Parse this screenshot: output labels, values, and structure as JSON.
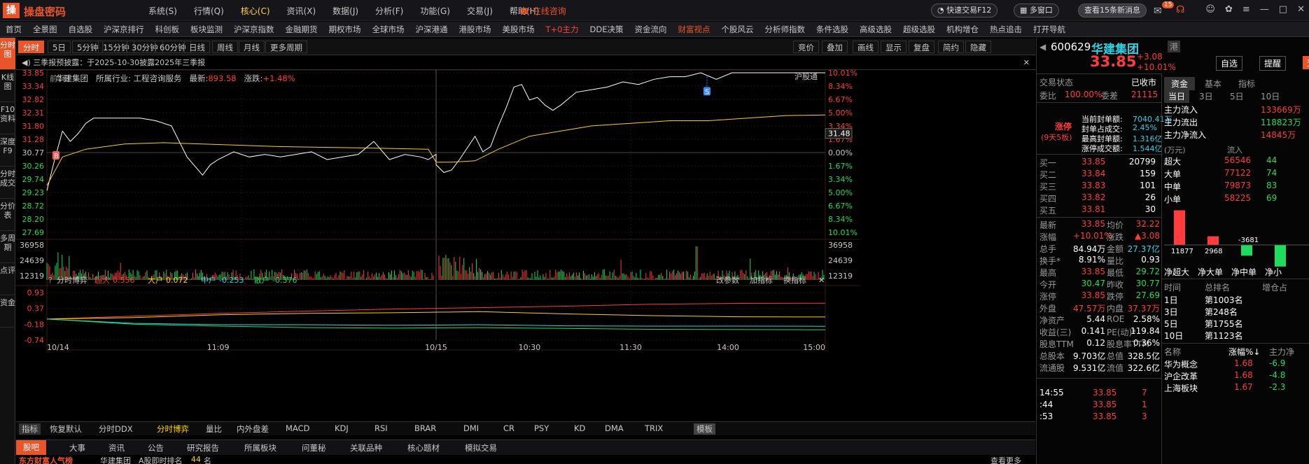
{
  "app": {
    "logo_char": "操",
    "name": "操盘密码"
  },
  "menu": [
    "系统(S)",
    "行情(Q)",
    "核心(C)",
    "资讯(X)",
    "数据(J)",
    "分析(F)",
    "功能(G)",
    "交易(J)",
    "帮助(H)"
  ],
  "menu_active": 2,
  "online_cs": "在线咨询",
  "title_right": {
    "quick_trade": "快速交易F12",
    "multi_window": "多窗口",
    "news": "查看15条新消息",
    "msg_badge": "15"
  },
  "navbar": [
    "首页",
    "全景图",
    "自选股",
    "沪深京排行",
    "科创板",
    "板块监测",
    "沪深京指数",
    "金融期货",
    "期权市场",
    "全球市场",
    "沪深港通",
    "港股市场",
    "美股市场",
    "T+0主力",
    "DDE决策",
    "资金流向",
    "财富视点",
    "个股风云",
    "分析师指数",
    "条件选股",
    "高级选股",
    "超级选股",
    "机构增仓",
    "热点追击",
    "打开导航"
  ],
  "leftbar": [
    "分时图",
    "K线图",
    "F10资料",
    "深度F9",
    "分时成交",
    "分价表",
    "多周期",
    "点评",
    "资金"
  ],
  "periods": [
    "分时",
    "5日",
    "5分钟",
    "15分钟",
    "30分钟",
    "60分钟",
    "日线",
    "周线",
    "月线",
    "更多周期"
  ],
  "chart_tools": [
    "竞价",
    "叠加",
    "画线",
    "显示",
    "复盘",
    "简约",
    "隐藏"
  ],
  "notice": "三季报预披露：于2025-10-30披露2025年三季报",
  "stockline": {
    "name": "华建集团",
    "industry_label": "所属行业:",
    "industry": "工程咨询服务",
    "latest_label": "最新:",
    "latest": "893.58",
    "change_label": "涨跌:",
    "change": "+1.48%"
  },
  "chart_labels": {
    "prev_day": "前1日",
    "hgt": "沪股通",
    "b_marker": "B",
    "s_marker": "S",
    "current_price_tag": "31.48"
  },
  "chart_data": {
    "type": "line",
    "price_axis": {
      "left": [
        "33.85",
        "33.34",
        "32.82",
        "32.31",
        "31.80",
        "31.28",
        "30.77",
        "30.26",
        "29.74",
        "29.23",
        "28.72",
        "28.20",
        "27.69"
      ],
      "right": [
        "10.01%",
        "8.34%",
        "6.67%",
        "5.00%",
        "3.34%",
        "1.67%",
        "0.00%",
        "1.67%",
        "3.34%",
        "5.00%",
        "6.67%",
        "8.34%",
        "10.01%"
      ],
      "ylim": [
        27.69,
        33.85
      ],
      "prev_close": 30.77
    },
    "volume_axis": [
      "36958",
      "24639",
      "12319"
    ],
    "x_labels": [
      "10/14",
      "11:09",
      "10/15",
      "10:30",
      "11:30",
      "14:00",
      "15:00"
    ],
    "series": [
      {
        "name": "价格",
        "color": "#ffffff",
        "x": [
          0,
          0.01,
          0.02,
          0.03,
          0.04,
          0.05,
          0.06,
          0.08,
          0.1,
          0.12,
          0.14,
          0.16,
          0.18,
          0.2,
          0.21,
          0.22,
          0.24,
          0.26,
          0.28,
          0.3,
          0.32,
          0.34,
          0.36,
          0.38,
          0.4,
          0.42,
          0.44,
          0.46,
          0.48,
          0.49,
          0.5,
          0.5,
          0.51,
          0.52,
          0.53,
          0.55,
          0.56,
          0.57,
          0.58,
          0.59,
          0.6,
          0.61,
          0.62,
          0.63,
          0.64,
          0.65,
          0.66,
          0.68,
          0.7,
          0.72,
          0.74,
          0.76,
          0.78,
          0.8,
          0.82,
          0.84,
          0.86,
          0.88,
          0.9,
          0.92,
          0.94,
          0.96,
          0.98,
          1.0
        ],
        "y": [
          29.3,
          30.5,
          31.6,
          31.2,
          31.5,
          31.9,
          32.1,
          32.1,
          32.1,
          32.1,
          32.0,
          31.8,
          30.6,
          29.9,
          30.3,
          30.5,
          30.8,
          30.6,
          30.7,
          30.6,
          30.7,
          30.8,
          30.5,
          30.6,
          30.7,
          31.2,
          30.5,
          30.7,
          30.6,
          30.5,
          30.7,
          30.3,
          30.0,
          30.1,
          30.5,
          31.4,
          30.8,
          31.0,
          31.8,
          32.5,
          33.3,
          33.4,
          32.8,
          32.9,
          32.6,
          32.4,
          32.6,
          33.1,
          33.2,
          33.3,
          33.5,
          33.4,
          33.6,
          33.7,
          33.7,
          33.85,
          33.6,
          33.85,
          33.85,
          33.85,
          33.85,
          33.85,
          33.85,
          33.85
        ]
      },
      {
        "name": "均价",
        "color": "#ffd200",
        "x": [
          0,
          0.02,
          0.05,
          0.1,
          0.15,
          0.2,
          0.3,
          0.4,
          0.49,
          0.5,
          0.52,
          0.55,
          0.58,
          0.62,
          0.66,
          0.7,
          0.75,
          0.8,
          0.85,
          0.9,
          0.95,
          1.0
        ],
        "y": [
          29.5,
          30.6,
          30.9,
          31.1,
          31.15,
          31.1,
          31.0,
          30.95,
          30.9,
          30.4,
          30.4,
          30.45,
          30.9,
          31.4,
          31.6,
          31.8,
          31.9,
          32.0,
          32.0,
          32.1,
          32.2,
          32.22
        ]
      }
    ],
    "indicator": {
      "title": "分时博弈",
      "series": [
        {
          "name": "超大",
          "value": "0.556",
          "color": "#ff3b3b"
        },
        {
          "name": "大户",
          "value": "0.072",
          "color": "#ffd200"
        },
        {
          "name": "中户",
          "value": "-0.253",
          "color": "#2cd3e6"
        },
        {
          "name": "散户",
          "value": "-0.376",
          "color": "#1edd5e"
        }
      ],
      "yaxis": [
        "0.93",
        "0.37",
        "-0.18",
        "-0.74"
      ],
      "ylim": [
        -0.74,
        0.93
      ],
      "lines": [
        {
          "color": "#ff3b3b",
          "y": [
            0.0,
            0.1,
            0.2,
            0.28,
            0.35,
            0.4,
            0.45,
            0.52,
            0.55,
            0.556
          ]
        },
        {
          "color": "#ffd200",
          "y": [
            0.0,
            0.05,
            0.15,
            0.2,
            0.22,
            0.26,
            0.18,
            0.12,
            0.08,
            0.072
          ]
        },
        {
          "color": "#2cd3e6",
          "y": [
            0.0,
            -0.15,
            -0.2,
            -0.2,
            -0.22,
            -0.2,
            -0.24,
            -0.25,
            -0.25,
            -0.253
          ]
        },
        {
          "color": "#1edd5e",
          "y": [
            0.0,
            -0.18,
            -0.25,
            -0.3,
            -0.32,
            -0.3,
            -0.33,
            -0.36,
            -0.37,
            -0.376
          ]
        }
      ]
    },
    "ind_buttons": [
      "改参数",
      "加指标",
      "换指标"
    ]
  },
  "indbar": [
    "指标",
    "恢复默认",
    "分时DDX",
    "分时博弈",
    "量比",
    "内外盘差",
    "MACD",
    "KDJ",
    "RSI",
    "BRAR",
    "DMI",
    "CR",
    "PSY",
    "KD",
    "DMA",
    "TRIX",
    "模板"
  ],
  "bottomtabs": [
    "股吧",
    "大事",
    "资讯",
    "公告",
    "研究报告",
    "所属板块",
    "问董秘",
    "关联品种",
    "核心题材",
    "模拟交易"
  ],
  "bottomrow": {
    "a": "东方财富人气榜",
    "b": "华建集团",
    "c": "A股即时排名",
    "d": "44",
    "e": "名",
    "f": "查看更多"
  },
  "quote": {
    "code": "600629",
    "name": "华建集团",
    "hk_tag": "港",
    "price": "33.85",
    "chg": "+3.08",
    "pct": "+10.01%",
    "btn_watch": "自选",
    "btn_alert": "提醒",
    "btn_trade": "交易",
    "trade_state_label": "交易状态",
    "trade_state": "已收市",
    "wb_label": "委比",
    "wb": "100.00%",
    "wc_label": "委差",
    "wc": "21115",
    "limit": {
      "tag": "涨停",
      "days": "(9天5板)",
      "rows": [
        [
          "当前封单额:",
          "7040.41万"
        ],
        [
          "封单占成交:",
          "2.45%"
        ],
        [
          "最高封单额:",
          "1.316亿"
        ],
        [
          "涨停成交额:",
          "1.544亿"
        ]
      ]
    },
    "bids": [
      [
        "买一",
        "33.85",
        "20799"
      ],
      [
        "买二",
        "33.84",
        "159"
      ],
      [
        "买三",
        "33.83",
        "101"
      ],
      [
        "买四",
        "33.82",
        "26"
      ],
      [
        "买五",
        "33.81",
        "30"
      ]
    ],
    "stats": [
      [
        "最新",
        "33.85",
        "均价",
        "32.22"
      ],
      [
        "涨幅",
        "+10.01%",
        "涨跌",
        "▲3.08"
      ],
      [
        "总手",
        "84.94万",
        "金额",
        "27.37亿"
      ],
      [
        "换手*",
        "8.91%",
        "量比",
        "0.93"
      ],
      [
        "最高",
        "33.85",
        "最低",
        "29.72"
      ],
      [
        "今开",
        "30.47",
        "昨收",
        "30.77"
      ],
      [
        "涨停",
        "33.85",
        "跌停",
        "27.69"
      ],
      [
        "外盘",
        "47.57万",
        "内盘",
        "37.37万"
      ],
      [
        "净资产",
        "5.44",
        "ROE",
        "2.58%"
      ],
      [
        "收益(三)",
        "0.141",
        "PE(动)*",
        "119.84"
      ],
      [
        "股息TTM",
        "0.12",
        "股息率TTM",
        "0.36%"
      ],
      [
        "总股本",
        "9.703亿",
        "总值",
        "328.5亿"
      ],
      [
        "流通股",
        "9.531亿",
        "流值",
        "322.6亿"
      ]
    ],
    "ticks": [
      [
        "14:55",
        "33.85",
        "7"
      ],
      [
        ":44",
        "33.85",
        "1"
      ],
      [
        ":53",
        "33.85",
        "3"
      ]
    ]
  },
  "fund": {
    "tabs": [
      "资金",
      "基本",
      "指标"
    ],
    "periods": [
      "当日",
      "3日",
      "5日",
      "10日"
    ],
    "rows": [
      [
        "主力流入",
        "133669万"
      ],
      [
        "主力流出",
        "118823万"
      ],
      [
        "主力净流入",
        "14845万"
      ]
    ],
    "unit": "(万元)",
    "col_in": "流入",
    "orders": [
      [
        "超大",
        "56546",
        "44"
      ],
      [
        "大单",
        "77122",
        "74"
      ],
      [
        "中单",
        "79873",
        "83"
      ],
      [
        "小单",
        "58225",
        "69"
      ]
    ],
    "bars": {
      "values": [
        11877,
        2968,
        -3681,
        -7400
      ],
      "labels": [
        "11877",
        "2968",
        "-3681",
        ""
      ],
      "names": [
        "净超大",
        "净大单",
        "净中单",
        "净小"
      ]
    },
    "rank_hdr": [
      "时间",
      "总排名",
      "增仓占"
    ],
    "ranks": [
      [
        "1日",
        "第1003名"
      ],
      [
        "3日",
        "第248名"
      ],
      [
        "5日",
        "第1755名"
      ],
      [
        "10日",
        "第1123名"
      ]
    ],
    "board_hdr": [
      "名称",
      "涨幅%↓",
      "主力净"
    ],
    "boards": [
      [
        "华为概念",
        "1.68",
        "-6.9"
      ],
      [
        "沪企改革",
        "1.68",
        "-4.8"
      ],
      [
        "上海板块",
        "1.67",
        "-2.3"
      ]
    ]
  }
}
